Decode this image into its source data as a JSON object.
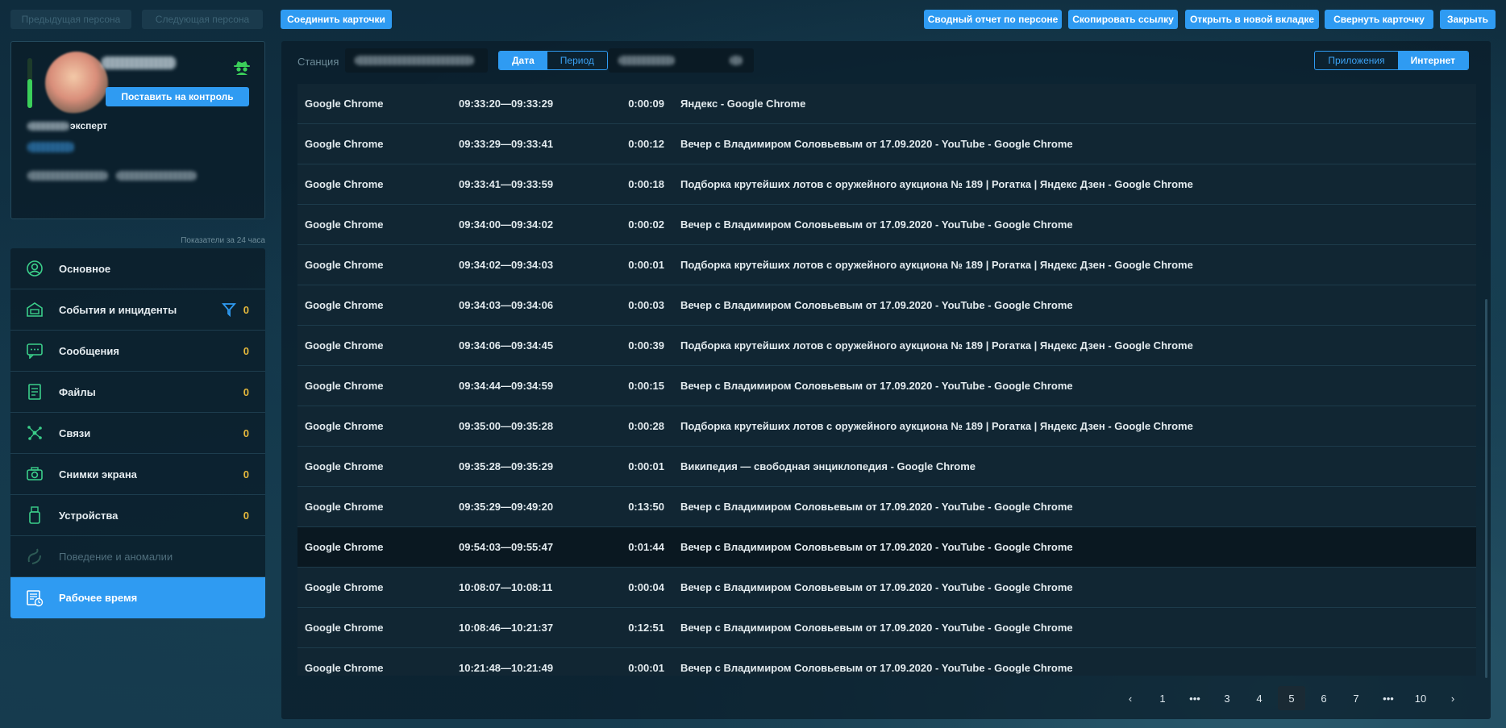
{
  "top_bar": {
    "prev_label": "Предыдущая персона",
    "next_label": "Следующая персона",
    "merge_label": "Соединить карточки",
    "report_label": "Сводный отчет по персоне",
    "copy_link_label": "Скопировать ссылку",
    "open_new_tab_label": "Открыть в новой вкладке",
    "collapse_label": "Свернуть карточку",
    "close_label": "Закрыть"
  },
  "profile": {
    "monitor_button_label": "Поставить на контроль",
    "role_suffix": "эксперт",
    "indicators_caption": "Показатели за 24 часа",
    "status_icon": "spy-icon",
    "accent_color": "#2f9bf2",
    "status_color": "#3bcf5a"
  },
  "menu": [
    {
      "label": "Основное",
      "icon": "person-icon",
      "count": ""
    },
    {
      "label": "События и инциденты",
      "icon": "incidents-icon",
      "count": "0",
      "filter": true
    },
    {
      "label": "Сообщения",
      "icon": "chat-icon",
      "count": "0"
    },
    {
      "label": "Файлы",
      "icon": "files-icon",
      "count": "0"
    },
    {
      "label": "Связи",
      "icon": "connections-icon",
      "count": "0"
    },
    {
      "label": "Снимки экрана",
      "icon": "camera-icon",
      "count": "0"
    },
    {
      "label": "Устройства",
      "icon": "usb-icon",
      "count": "0"
    },
    {
      "label": "Поведение и аномалии",
      "icon": "behavior-icon",
      "count": "",
      "disabled": true
    },
    {
      "label": "Рабочее время",
      "icon": "worktime-icon",
      "count": "",
      "active": true
    }
  ],
  "panel": {
    "station_label": "Станция",
    "date_label": "Дата",
    "period_label": "Период",
    "apps_label": "Приложения",
    "internet_label": "Интернет"
  },
  "rows": [
    {
      "app": "Google Chrome",
      "time": "09:33:20—09:33:29",
      "duration": "0:00:09",
      "title": "Яндекс - Google Chrome"
    },
    {
      "app": "Google Chrome",
      "time": "09:33:29—09:33:41",
      "duration": "0:00:12",
      "title": "Вечер с Владимиром Соловьевым от 17.09.2020 - YouTube - Google Chrome"
    },
    {
      "app": "Google Chrome",
      "time": "09:33:41—09:33:59",
      "duration": "0:00:18",
      "title": "Подборка крутейших лотов с оружейного аукциона № 189 | Рогатка | Яндекс Дзен - Google Chrome"
    },
    {
      "app": "Google Chrome",
      "time": "09:34:00—09:34:02",
      "duration": "0:00:02",
      "title": "Вечер с Владимиром Соловьевым от 17.09.2020 - YouTube - Google Chrome"
    },
    {
      "app": "Google Chrome",
      "time": "09:34:02—09:34:03",
      "duration": "0:00:01",
      "title": "Подборка крутейших лотов с оружейного аукциона № 189 | Рогатка | Яндекс Дзен - Google Chrome"
    },
    {
      "app": "Google Chrome",
      "time": "09:34:03—09:34:06",
      "duration": "0:00:03",
      "title": "Вечер с Владимиром Соловьевым от 17.09.2020 - YouTube - Google Chrome"
    },
    {
      "app": "Google Chrome",
      "time": "09:34:06—09:34:45",
      "duration": "0:00:39",
      "title": "Подборка крутейших лотов с оружейного аукциона № 189 | Рогатка | Яндекс Дзен - Google Chrome"
    },
    {
      "app": "Google Chrome",
      "time": "09:34:44—09:34:59",
      "duration": "0:00:15",
      "title": "Вечер с Владимиром Соловьевым от 17.09.2020 - YouTube - Google Chrome"
    },
    {
      "app": "Google Chrome",
      "time": "09:35:00—09:35:28",
      "duration": "0:00:28",
      "title": "Подборка крутейших лотов с оружейного аукциона № 189 | Рогатка | Яндекс Дзен - Google Chrome"
    },
    {
      "app": "Google Chrome",
      "time": "09:35:28—09:35:29",
      "duration": "0:00:01",
      "title": "Википедия — свободная энциклопедия - Google Chrome"
    },
    {
      "app": "Google Chrome",
      "time": "09:35:29—09:49:20",
      "duration": "0:13:50",
      "title": "Вечер с Владимиром Соловьевым от 17.09.2020 - YouTube - Google Chrome"
    },
    {
      "app": "Google Chrome",
      "time": "09:54:03—09:55:47",
      "duration": "0:01:44",
      "title": "Вечер с Владимиром Соловьевым от 17.09.2020 - YouTube - Google Chrome",
      "highlight": true
    },
    {
      "app": "Google Chrome",
      "time": "10:08:07—10:08:11",
      "duration": "0:00:04",
      "title": "Вечер с Владимиром Соловьевым от 17.09.2020 - YouTube - Google Chrome"
    },
    {
      "app": "Google Chrome",
      "time": "10:08:46—10:21:37",
      "duration": "0:12:51",
      "title": "Вечер с Владимиром Соловьевым от 17.09.2020 - YouTube - Google Chrome"
    },
    {
      "app": "Google Chrome",
      "time": "10:21:48—10:21:49",
      "duration": "0:00:01",
      "title": "Вечер с Владимиром Соловьевым от 17.09.2020 - YouTube - Google Chrome"
    }
  ],
  "pagination": {
    "prev": "‹",
    "next": "›",
    "pages": [
      "1",
      "•••",
      "3",
      "4",
      "5",
      "6",
      "7",
      "•••",
      "10"
    ],
    "current": "5"
  }
}
